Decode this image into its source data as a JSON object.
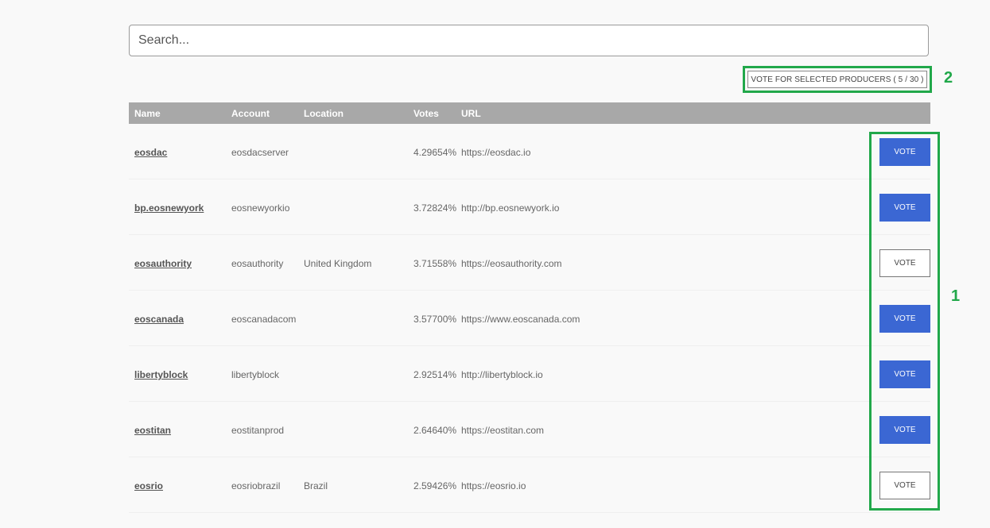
{
  "search": {
    "placeholder": "Search..."
  },
  "vote_selected": {
    "label": "VOTE FOR SELECTED PRODUCERS ( 5 / 30 )"
  },
  "annotations": {
    "label_1": "1",
    "label_2": "2",
    "color": "#21a84a"
  },
  "table": {
    "headers": {
      "name": "Name",
      "account": "Account",
      "location": "Location",
      "votes": "Votes",
      "url": "URL"
    },
    "vote_label": "VOTE",
    "rows": [
      {
        "name": "eosdac",
        "account": "eosdacserver",
        "location": "",
        "votes": "4.29654%",
        "url": "https://eosdac.io",
        "voted": true
      },
      {
        "name": "bp.eosnewyork",
        "account": "eosnewyorkio",
        "location": "",
        "votes": "3.72824%",
        "url": "http://bp.eosnewyork.io",
        "voted": true
      },
      {
        "name": "eosauthority",
        "account": "eosauthority",
        "location": "United Kingdom",
        "votes": "3.71558%",
        "url": "https://eosauthority.com",
        "voted": false
      },
      {
        "name": "eoscanada",
        "account": "eoscanadacom",
        "location": "",
        "votes": "3.57700%",
        "url": "https://www.eoscanada.com",
        "voted": true
      },
      {
        "name": "libertyblock",
        "account": "libertyblock",
        "location": "",
        "votes": "2.92514%",
        "url": "http://libertyblock.io",
        "voted": true
      },
      {
        "name": "eostitan",
        "account": "eostitanprod",
        "location": "",
        "votes": "2.64640%",
        "url": "https://eostitan.com",
        "voted": true
      },
      {
        "name": "eosrio",
        "account": "eosriobrazil",
        "location": "Brazil",
        "votes": "2.59426%",
        "url": "https://eosrio.io",
        "voted": false
      }
    ]
  },
  "colors": {
    "header_bg": "#a8a8a8",
    "vote_active": "#3b67d3",
    "highlight": "#21a84a"
  }
}
